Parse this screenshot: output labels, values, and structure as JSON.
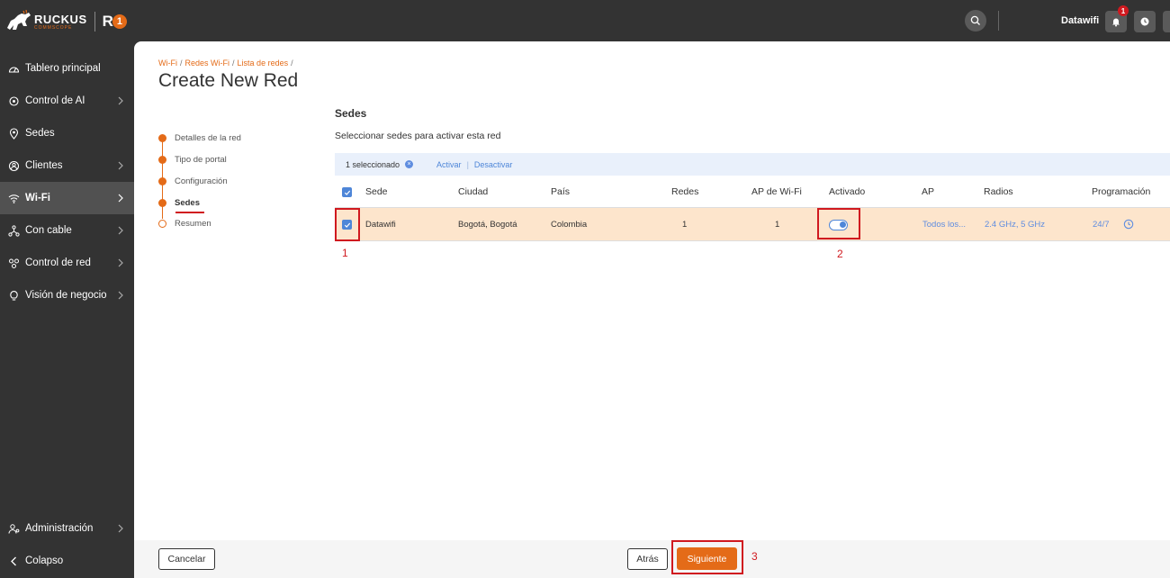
{
  "brand": {
    "wordmark": "RUCKUS",
    "sub": "COMMSCOPE",
    "r": "R",
    "one": "1"
  },
  "topbar": {
    "user": "Datawifi",
    "notification_count": "1"
  },
  "sidebar": {
    "items": [
      {
        "label": "Tablero principal",
        "icon": "dashboard-icon",
        "chevron": false
      },
      {
        "label": "Control de AI",
        "icon": "ai-icon",
        "chevron": true
      },
      {
        "label": "Sedes",
        "icon": "location-icon",
        "chevron": false
      },
      {
        "label": "Clientes",
        "icon": "clients-icon",
        "chevron": true
      },
      {
        "label": "Wi-Fi",
        "icon": "wifi-icon",
        "chevron": true,
        "active": true
      },
      {
        "label": "Con cable",
        "icon": "wired-icon",
        "chevron": true
      },
      {
        "label": "Control de red",
        "icon": "network-control-icon",
        "chevron": true
      },
      {
        "label": "Visión de negocio",
        "icon": "lightbulb-icon",
        "chevron": true
      }
    ],
    "admin": "Administración",
    "collapse": "Colapso"
  },
  "breadcrumb": [
    "Wi-Fi",
    "Redes Wi-Fi",
    "Lista de redes"
  ],
  "page": {
    "title": "Create New Red"
  },
  "steps": [
    {
      "label": "Detalles de la red",
      "state": "done"
    },
    {
      "label": "Tipo de portal",
      "state": "done"
    },
    {
      "label": "Configuración",
      "state": "done"
    },
    {
      "label": "Sedes",
      "state": "current"
    },
    {
      "label": "Resumen",
      "state": "pending"
    }
  ],
  "section": {
    "title": "Sedes",
    "subtitle": "Seleccionar sedes para activar esta red"
  },
  "selection_bar": {
    "count": "1 seleccionado",
    "activate": "Activar",
    "deactivate": "Desactivar"
  },
  "table": {
    "headers": [
      "Sede",
      "Ciudad",
      "País",
      "Redes",
      "AP de Wi-Fi",
      "Activado",
      "AP",
      "Radios",
      "Programación"
    ],
    "rows": [
      {
        "sede": "Datawifi",
        "ciudad": "Bogotá, Bogotá",
        "pais": "Colombia",
        "redes": "1",
        "ap_wifi": "1",
        "activado": true,
        "ap": "Todos los...",
        "radios": "2.4 GHz, 5 GHz",
        "programacion": "24/7",
        "checked": true
      }
    ]
  },
  "annotations": [
    "1",
    "2",
    "3"
  ],
  "footer": {
    "cancel": "Cancelar",
    "back": "Atrás",
    "next": "Siguiente"
  },
  "colors": {
    "accent": "#e46b18",
    "sidebar": "#333333",
    "link": "#4e86d8",
    "row_highlight": "#fde5cc",
    "callout": "#d0191f"
  }
}
